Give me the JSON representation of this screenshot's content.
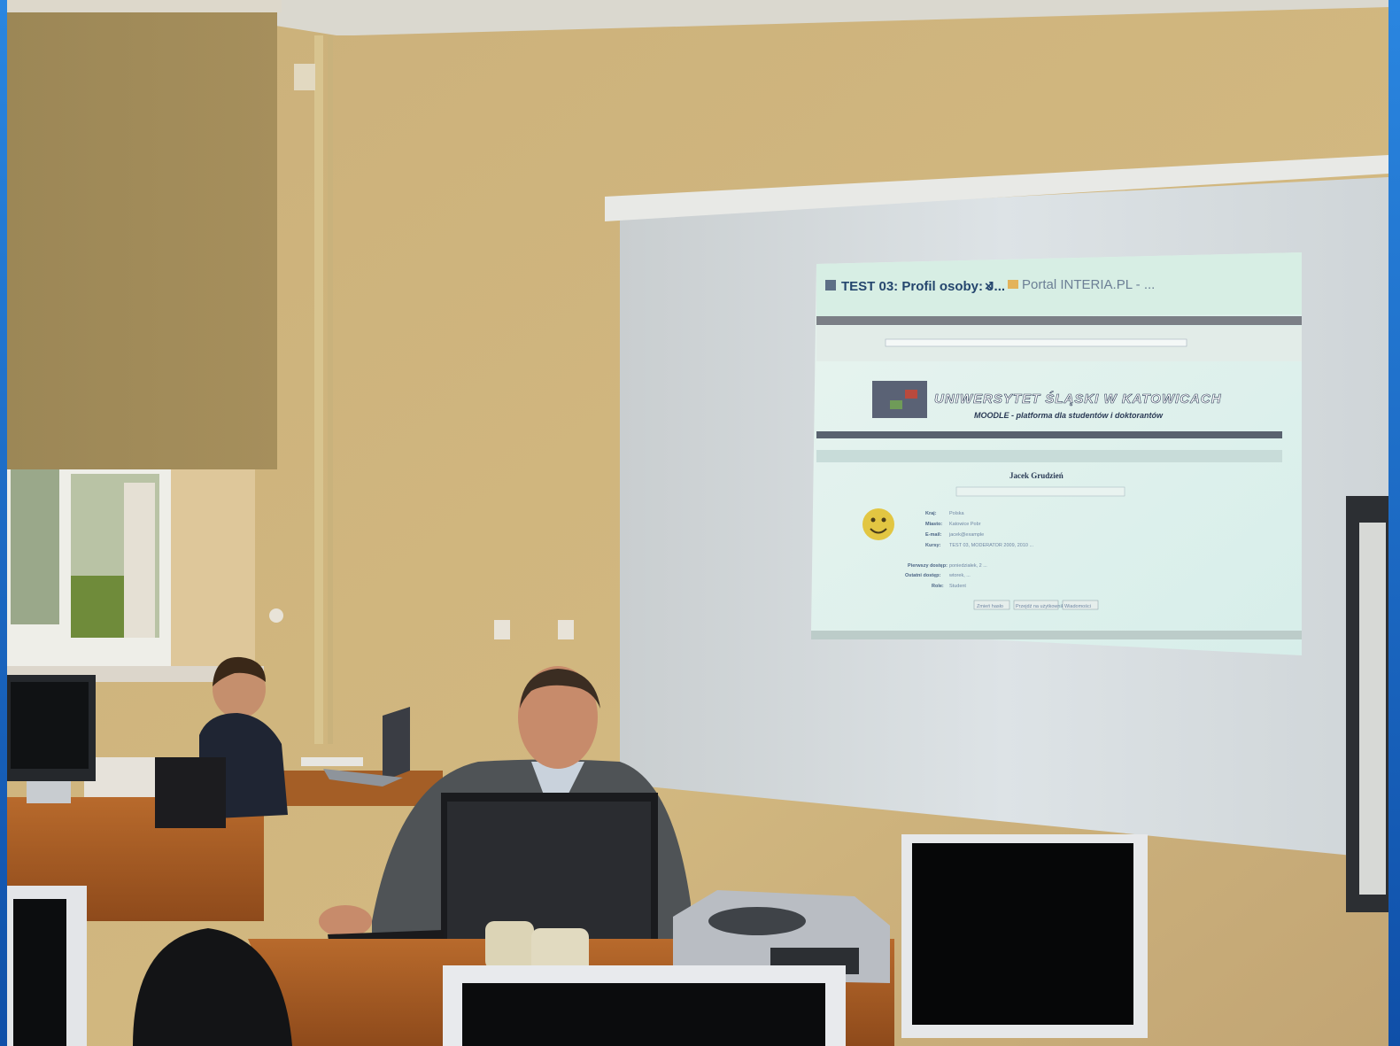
{
  "projection": {
    "tab_active": "TEST 03: Profil osoby: J...",
    "tab_close": "×",
    "tab_other": "Portal INTERIA.PL - ...",
    "banner_title": "UNIWERSYTET ŚLĄSKI W KATOWICACH",
    "banner_subtitle": "MOODLE - platforma dla studentów i doktorantów",
    "profile_name": "Jacek Grudzień",
    "fields": [
      {
        "label": "Kraj:",
        "value": "Polska"
      },
      {
        "label": "Miasto:",
        "value": "Katowice Pobr"
      },
      {
        "label": "E-mail:",
        "value": "jacek@example"
      },
      {
        "label": "Kursy:",
        "value": "TEST 03, MODERATOR 2009, 2010 ..."
      },
      {
        "label": "Pierwszy dostęp:",
        "value": "poniedziałek, 2 ..."
      },
      {
        "label": "Ostatni dostęp:",
        "value": "wtorek, ..."
      },
      {
        "label": "Role:",
        "value": "Student"
      }
    ],
    "buttons": [
      "Zmień hasło",
      "Przejdź na użytkownika",
      "Wiadomości"
    ]
  },
  "colors": {
    "frame_blue": "#1a6fc9",
    "wall": "#cfb27a",
    "screen": "#d9e2ea"
  }
}
